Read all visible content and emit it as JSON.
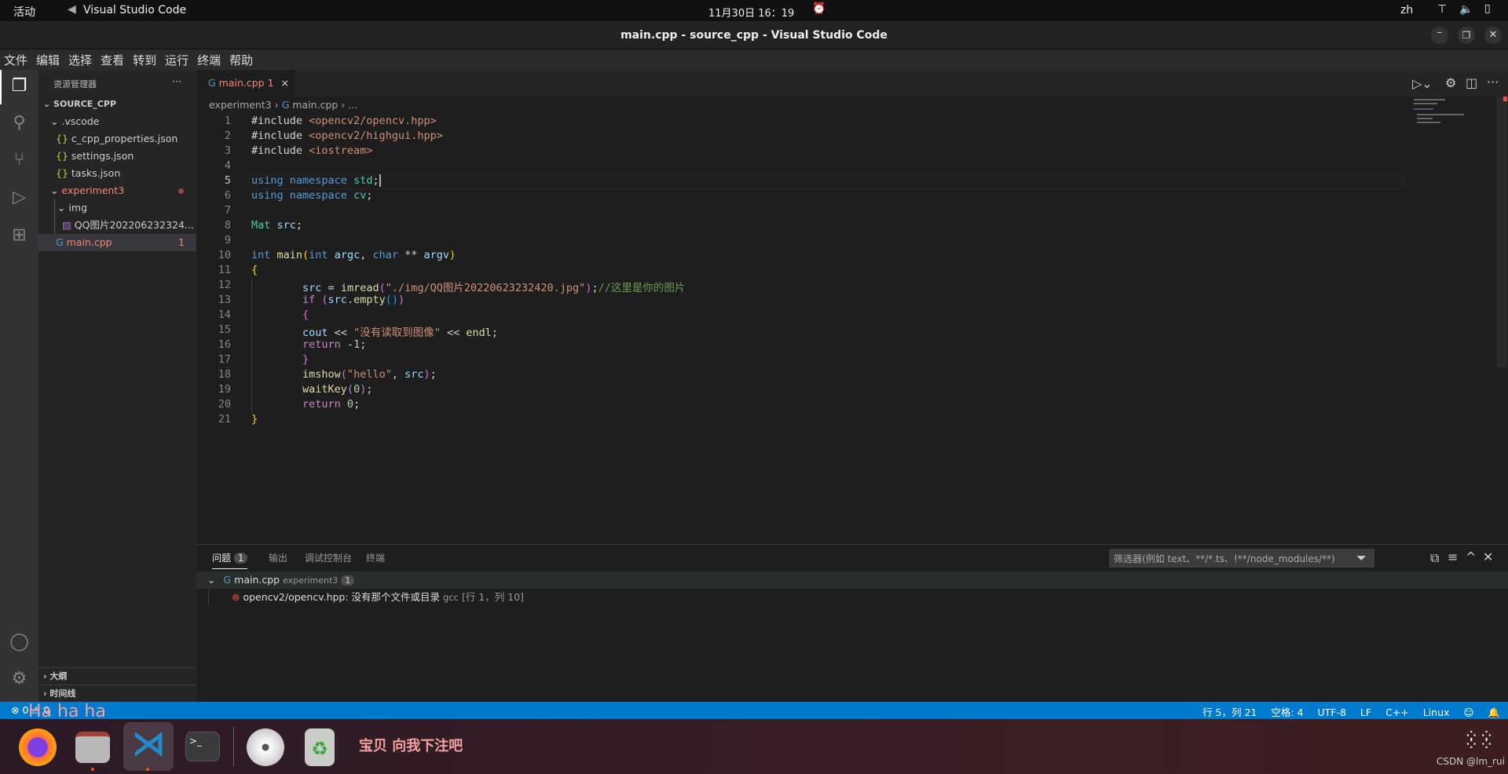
{
  "topbar": {
    "activities": "活动",
    "app": "Visual Studio Code",
    "datetime": "11月30日  16：19",
    "lang": "zh"
  },
  "window": {
    "title": "main.cpp - source_cpp - Visual Studio Code"
  },
  "menu": [
    "文件",
    "编辑",
    "选择",
    "查看",
    "转到",
    "运行",
    "终端",
    "帮助"
  ],
  "sidebar": {
    "title": "资源管理器",
    "more": "···",
    "root": "SOURCE_CPP",
    "items": [
      {
        "label": ".vscode",
        "kind": "folder"
      },
      {
        "label": "c_cpp_properties.json",
        "kind": "json"
      },
      {
        "label": "settings.json",
        "kind": "json"
      },
      {
        "label": "tasks.json",
        "kind": "json"
      },
      {
        "label": "experiment3",
        "kind": "folder"
      },
      {
        "label": "img",
        "kind": "folder"
      },
      {
        "label": "QQ图片202206232324...",
        "kind": "image"
      },
      {
        "label": "main.cpp",
        "kind": "cpp",
        "badge": "1"
      }
    ],
    "outline": "大纲",
    "timeline": "时间线"
  },
  "tab": {
    "label": "main.cpp",
    "badge": "1",
    "close": "×"
  },
  "breadcrumb": [
    "experiment3",
    "main.cpp",
    "..."
  ],
  "code": [
    [
      [
        "#include ",
        "p"
      ],
      [
        "<opencv2/opencv.hpp>",
        "s"
      ]
    ],
    [
      [
        "#include ",
        "p"
      ],
      [
        "<opencv2/highgui.hpp>",
        "s"
      ]
    ],
    [
      [
        "#include ",
        "p"
      ],
      [
        "<iostream>",
        "s"
      ]
    ],
    [],
    [
      [
        "using ",
        "k"
      ],
      [
        "namespace ",
        "k"
      ],
      [
        "std",
        "t"
      ],
      [
        ";",
        "p"
      ]
    ],
    [
      [
        "using ",
        "k"
      ],
      [
        "namespace ",
        "k"
      ],
      [
        "cv",
        "t"
      ],
      [
        ";",
        "p"
      ]
    ],
    [],
    [
      [
        "Mat ",
        "t"
      ],
      [
        "src",
        "v"
      ],
      [
        ";",
        "p"
      ]
    ],
    [],
    [
      [
        "int ",
        "k"
      ],
      [
        "main",
        "f"
      ],
      [
        "(",
        "b1"
      ],
      [
        "int ",
        "k"
      ],
      [
        "argc",
        "v"
      ],
      [
        ", ",
        "p"
      ],
      [
        "char ",
        "k"
      ],
      [
        "** ",
        "p"
      ],
      [
        "argv",
        "v"
      ],
      [
        ")",
        "b1"
      ]
    ],
    [
      [
        "{",
        "b1"
      ]
    ],
    [
      [
        "        src ",
        "v"
      ],
      [
        "= ",
        "p"
      ],
      [
        "imread",
        "f"
      ],
      [
        "(",
        "b2"
      ],
      [
        "\"./img/QQ图片20220623232420.jpg\"",
        "s"
      ],
      [
        ")",
        "b2"
      ],
      [
        ";",
        "p"
      ],
      [
        "//这里是你的图片",
        "cm"
      ]
    ],
    [
      [
        "        if ",
        "c"
      ],
      [
        "(",
        "b2"
      ],
      [
        "src",
        "v"
      ],
      [
        ".",
        "p"
      ],
      [
        "empty",
        "f"
      ],
      [
        "()",
        "b3"
      ],
      [
        ")",
        "b2"
      ]
    ],
    [
      [
        "        {",
        "b2"
      ]
    ],
    [
      [
        "        cout ",
        "v"
      ],
      [
        "<< ",
        "p"
      ],
      [
        "\"没有读取到图像\" ",
        "s"
      ],
      [
        "<< ",
        "p"
      ],
      [
        "endl",
        "f"
      ],
      [
        ";",
        "p"
      ]
    ],
    [
      [
        "        return ",
        "c"
      ],
      [
        "-",
        "p"
      ],
      [
        "1",
        "n"
      ],
      [
        ";",
        "p"
      ]
    ],
    [
      [
        "        }",
        "b2"
      ]
    ],
    [
      [
        "        imshow",
        "f"
      ],
      [
        "(",
        "b2"
      ],
      [
        "\"hello\"",
        "s"
      ],
      [
        ", ",
        "p"
      ],
      [
        "src",
        "v"
      ],
      [
        ")",
        "b2"
      ],
      [
        ";",
        "p"
      ]
    ],
    [
      [
        "        waitKey",
        "f"
      ],
      [
        "(",
        "b2"
      ],
      [
        "0",
        "n"
      ],
      [
        ")",
        "b2"
      ],
      [
        ";",
        "p"
      ]
    ],
    [
      [
        "        return ",
        "c"
      ],
      [
        "0",
        "n"
      ],
      [
        ";",
        "p"
      ]
    ],
    [
      [
        "}",
        "b1"
      ]
    ]
  ],
  "current_line": 5,
  "panel": {
    "tabs": [
      {
        "label": "问题",
        "badge": "1"
      },
      {
        "label": "输出"
      },
      {
        "label": "调试控制台"
      },
      {
        "label": "终端"
      }
    ],
    "filter_placeholder": "筛选器(例如 text、**/*.ts、!**/node_modules/**)",
    "file": {
      "name": "main.cpp",
      "folder": "experiment3",
      "count": "1"
    },
    "error": {
      "message": "opencv2/opencv.hpp: 没有那个文件或目录",
      "source": "gcc",
      "location": "[行 1，列 10]"
    }
  },
  "status": {
    "errors": "0",
    "warnings": "0",
    "position": "行 5，列 21",
    "spaces": "空格: 4",
    "encoding": "UTF-8",
    "eol": "LF",
    "language": "C++",
    "os": "Linux"
  },
  "dock": {
    "overlay": "Ha ha ha",
    "caption": "宝贝 向我下注吧",
    "watermark": "CSDN @lm_rui"
  },
  "colors": {
    "accent": "#007acc",
    "error": "#f14c4c",
    "modified": "#f48771"
  }
}
